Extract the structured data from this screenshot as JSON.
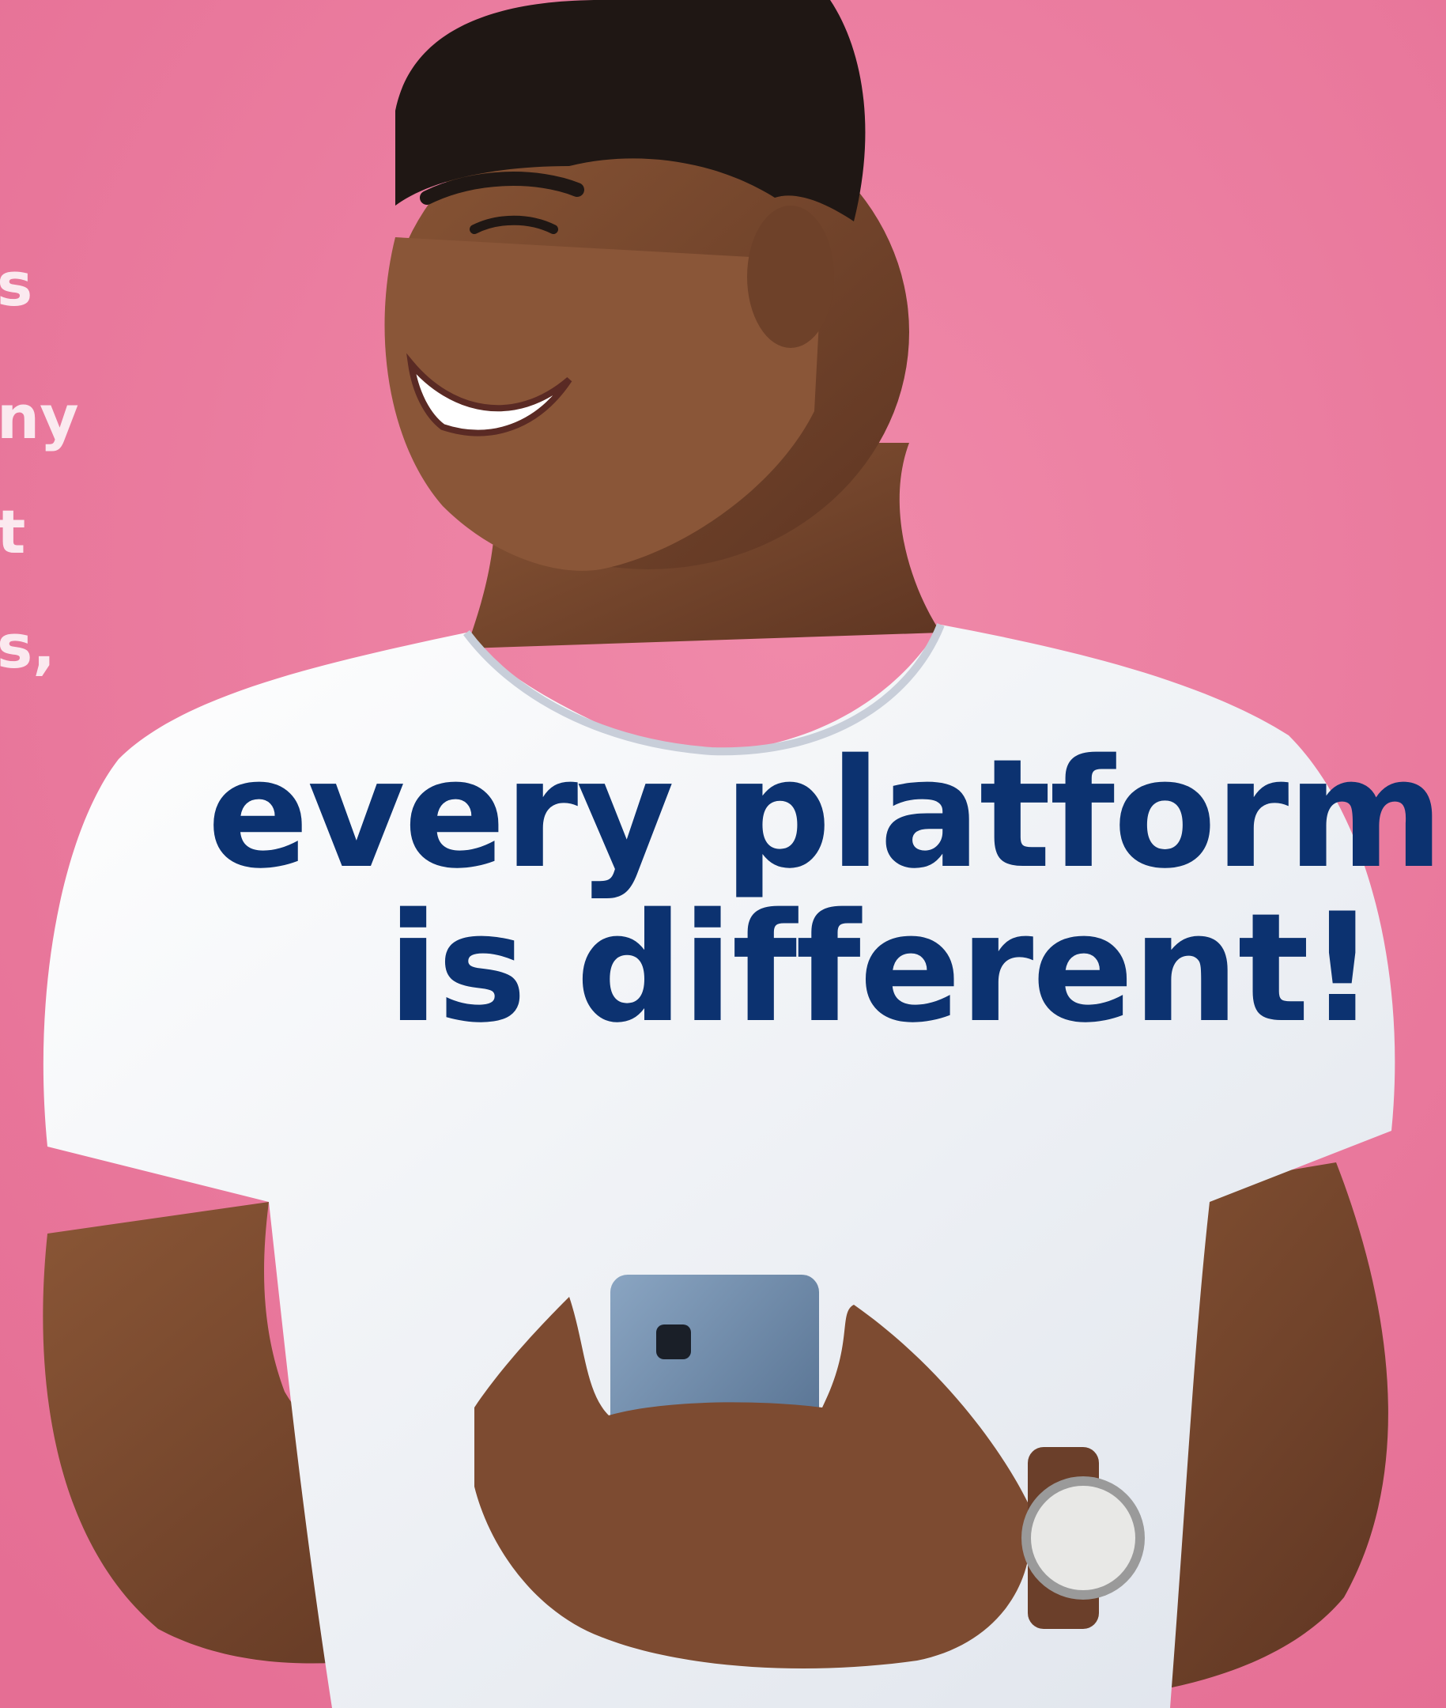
{
  "side_text": {
    "fragments": [
      "s",
      "ny",
      "t",
      "s,"
    ]
  },
  "headline": {
    "line1": "every platform",
    "line2": "is different!",
    "color": "#0c3270"
  },
  "colors": {
    "background": "#e9769a",
    "shirt": "#f2f4f8",
    "skin": "#7a4a32",
    "phone": "#6e8bab",
    "side_text": "#fbe9ef"
  },
  "scene": {
    "subject": "smiling-man-holding-phone-photo"
  }
}
